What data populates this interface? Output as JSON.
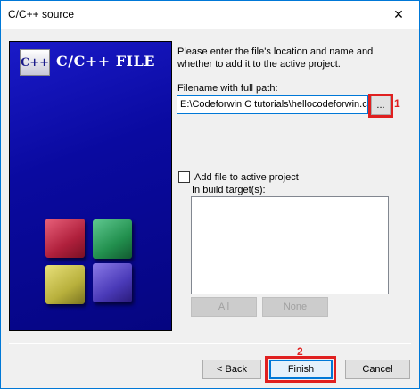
{
  "window": {
    "title": "C/C++ source",
    "close_symbol": "✕"
  },
  "banner": {
    "logo_text": "C++",
    "title": "C/C++ FILE"
  },
  "description": "Please enter the file's location and name and whether to add it to the active project.",
  "filename": {
    "label": "Filename with full path:",
    "value": "E:\\Codeforwin C tutorials\\hellocodeforwin.c",
    "browse_label": "..."
  },
  "annotations": {
    "step1": "1",
    "step2": "2",
    "color": "#e02020"
  },
  "add_to_project": {
    "label": "Add file to active project",
    "checked": false
  },
  "build_targets": {
    "label": "In build target(s):",
    "items": []
  },
  "target_buttons": {
    "all_label": "All",
    "none_label": "None"
  },
  "footer": {
    "back_label": "< Back",
    "finish_label": "Finish",
    "cancel_label": "Cancel"
  },
  "colors": {
    "accent": "#0078d7",
    "banner_blue": "#0a0aa0",
    "highlight": "#e02020"
  }
}
